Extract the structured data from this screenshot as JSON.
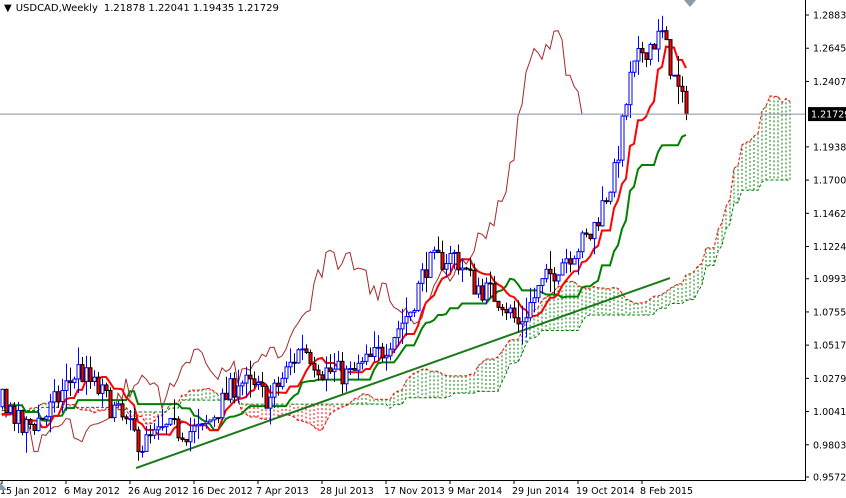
{
  "header": {
    "symbol": "USDCAD,Weekly",
    "ohlc": "1.21878 1.22041 1.19435 1.21729",
    "menu_icon": "triangle-down-icon"
  },
  "colors": {
    "bull": "#0000ff",
    "bear_body": "#ff0000",
    "bear_outline": "#000000",
    "tenkan": "#ff0000",
    "kijun": "#008000",
    "chikou": "#a52a2a",
    "cloud_up": "#008000",
    "cloud_down": "#ff0000",
    "trendline": "#1a7a1a",
    "price_line": "#8090a0"
  },
  "chart_data": {
    "type": "candlestick",
    "title": "USDCAD,Weekly",
    "indicator": "Ichimoku Kinko Hyo (9,26,52)",
    "current_price": 1.21729,
    "current_price_label": "1.21729",
    "ylim": [
      0.9572,
      1.2883
    ],
    "y_ticks": [
      "1.28830",
      "1.26450",
      "1.24070",
      "1.19380",
      "1.17000",
      "1.14620",
      "1.12240",
      "1.09930",
      "1.07550",
      "1.05170",
      "1.02790",
      "1.00410",
      "0.98030",
      "0.95720"
    ],
    "y_tick_values": [
      1.2883,
      1.2645,
      1.2407,
      1.1938,
      1.17,
      1.1462,
      1.1224,
      1.0993,
      1.0755,
      1.0517,
      1.0279,
      1.0041,
      0.9803,
      0.9572
    ],
    "x_ticks": [
      "15 Jan 2012",
      "6 May 2012",
      "26 Aug 2012",
      "16 Dec 2012",
      "7 Apr 2013",
      "28 Jul 2013",
      "17 Nov 2013",
      "9 Mar 2014",
      "29 Jun 2014",
      "19 Oct 2014",
      "8 Feb 2015"
    ],
    "x_tick_weeks": [
      0,
      16,
      32,
      48,
      64,
      80,
      96,
      112,
      128,
      144,
      160
    ],
    "close_path_week_price": [
      [
        0,
        1.016
      ],
      [
        5,
        0.991
      ],
      [
        11,
        1.002
      ],
      [
        19,
        1.034
      ],
      [
        25,
        1.016
      ],
      [
        35,
        0.98
      ],
      [
        41,
        0.991
      ],
      [
        50,
        0.99
      ],
      [
        59,
        1.027
      ],
      [
        67,
        1.013
      ],
      [
        75,
        1.052
      ],
      [
        80,
        1.034
      ],
      [
        87,
        1.03
      ],
      [
        95,
        1.048
      ],
      [
        102,
        1.077
      ],
      [
        106,
        1.109
      ],
      [
        113,
        1.116
      ],
      [
        118,
        1.095
      ],
      [
        125,
        1.084
      ],
      [
        129,
        1.066
      ],
      [
        134,
        1.091
      ],
      [
        140,
        1.113
      ],
      [
        147,
        1.13
      ],
      [
        153,
        1.174
      ],
      [
        157,
        1.242
      ],
      [
        160,
        1.263
      ],
      [
        165,
        1.274
      ],
      [
        168,
        1.242
      ],
      [
        171,
        1.2173
      ]
    ],
    "trendline": {
      "from_week": 33.5,
      "from_price": 0.9636,
      "to_week": 167,
      "to_price": 1.0998
    }
  }
}
